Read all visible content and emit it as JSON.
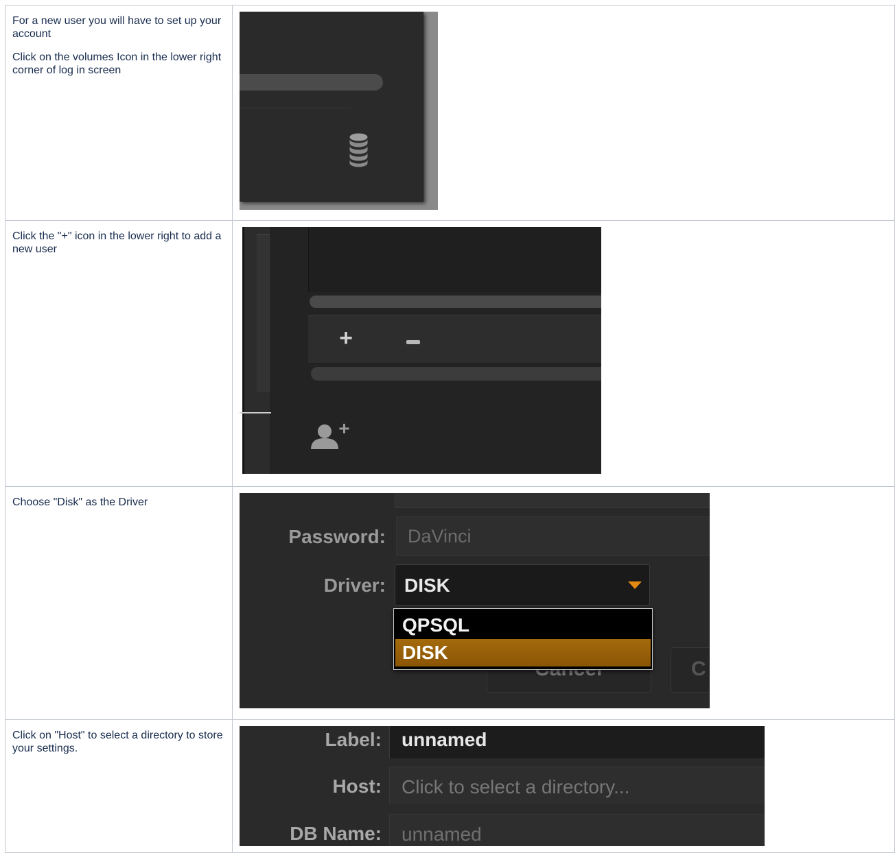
{
  "rows": [
    {
      "lines": [
        "For a new user you will have to set up your account",
        "Click on the volumes Icon in the lower right corner of log in screen"
      ]
    },
    {
      "lines": [
        "Click the \"+\" icon in the lower right to add a new user"
      ],
      "buttons": {
        "add": "+"
      }
    },
    {
      "lines": [
        "Choose \"Disk\" as the Driver"
      ],
      "form": {
        "password_label": "Password:",
        "password_value": "DaVinci",
        "driver_label": "Driver:",
        "driver_value": "DISK",
        "driver_options": [
          "QPSQL",
          "DISK"
        ],
        "cancel_label": "Cancel",
        "other_button_label": "C",
        "accent_color": "#e38a12"
      }
    },
    {
      "lines": [
        "Click on \"Host\" to select a directory to store your settings."
      ],
      "form": {
        "label_label": "Label:",
        "label_value": "unnamed",
        "host_label": "Host:",
        "host_placeholder": "Click to select a directory...",
        "dbname_label": "DB Name:",
        "dbname_value": "unnamed"
      }
    }
  ]
}
